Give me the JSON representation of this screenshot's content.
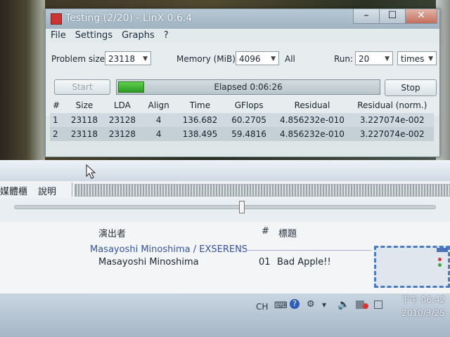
{
  "linx": {
    "title": "Testing (2/20) - LinX 0.6.4",
    "menu": [
      "File",
      "Settings",
      "Graphs",
      "?"
    ],
    "problem_size": {
      "label": "Problem size:",
      "value": "23118"
    },
    "memory": {
      "label": "Memory (MiB):",
      "value": "4096",
      "all_label": "All"
    },
    "run": {
      "label": "Run:",
      "value": "20",
      "unit": "times"
    },
    "start_label": "Start",
    "stop_label": "Stop",
    "progress": {
      "fraction": 0.1,
      "text": "Elapsed 0:06:26"
    },
    "table": {
      "headers": [
        "#",
        "Size",
        "LDA",
        "Align",
        "Time",
        "GFlops",
        "Residual",
        "Residual (norm.)"
      ],
      "rows": [
        [
          "1",
          "23118",
          "23128",
          "4",
          "136.682",
          "60.2705",
          "4.856232e-010",
          "3.227074e-002"
        ],
        [
          "2",
          "23118",
          "23128",
          "4",
          "138.495",
          "59.4816",
          "4.856232e-010",
          "3.227074e-002"
        ]
      ]
    }
  },
  "player": {
    "menu": [
      "媒體櫃",
      "說明"
    ],
    "seek_position": 0.54,
    "columns": {
      "artist": "演出者",
      "number": "#",
      "title": "標題"
    },
    "group": "Masayoshi Minoshima / EXSERENS",
    "tracks": [
      {
        "artist": "Masayoshi Minoshima",
        "number": "01",
        "title": "Bad Apple!!"
      }
    ]
  },
  "taskbar": {
    "lang": "CH",
    "time": "下午 06:42",
    "date": "2010/3/25"
  },
  "colors": {
    "progress_fill": "#3cb334",
    "link_blue": "#3552a3"
  }
}
